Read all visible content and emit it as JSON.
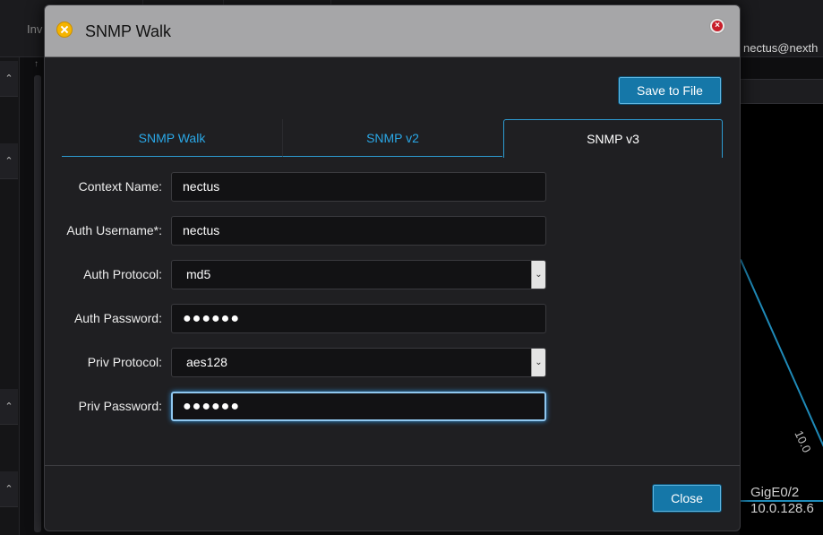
{
  "background": {
    "topbar_label": "Inv",
    "user": "nectus@nexth",
    "link_label": "10.0",
    "port_name": "GigE0/2",
    "port_ip": "10.0.128.6",
    "sidebar_glyph": "⌃"
  },
  "dialog": {
    "title": "SNMP Walk",
    "close_glyph": "×",
    "save_label": "Save to File",
    "close_label": "Close",
    "tabs": [
      {
        "label": "SNMP Walk",
        "active": false
      },
      {
        "label": "SNMP v2",
        "active": false
      },
      {
        "label": "SNMP v3",
        "active": true
      }
    ],
    "fields": {
      "context_name": {
        "label": "Context Name:",
        "value": "nectus"
      },
      "auth_username": {
        "label": "Auth Username*:",
        "value": "nectus"
      },
      "auth_protocol": {
        "label": "Auth Protocol:",
        "value": "md5"
      },
      "auth_password": {
        "label": "Auth Password:",
        "value": "●●●●●●"
      },
      "priv_protocol": {
        "label": "Priv Protocol:",
        "value": "aes128"
      },
      "priv_password": {
        "label": "Priv Password:",
        "value": "●●●●●●"
      }
    },
    "select_arrow_glyph": "⌄"
  },
  "colors": {
    "accent": "#1577a8",
    "tab_link": "#2aa7e6",
    "titlebar": "#a6a6a8",
    "dialog_bg": "#1f1f22"
  },
  "icons": [
    "app-logo-icon",
    "close-icon",
    "chevron-down-icon",
    "double-chevron-up-icon"
  ]
}
